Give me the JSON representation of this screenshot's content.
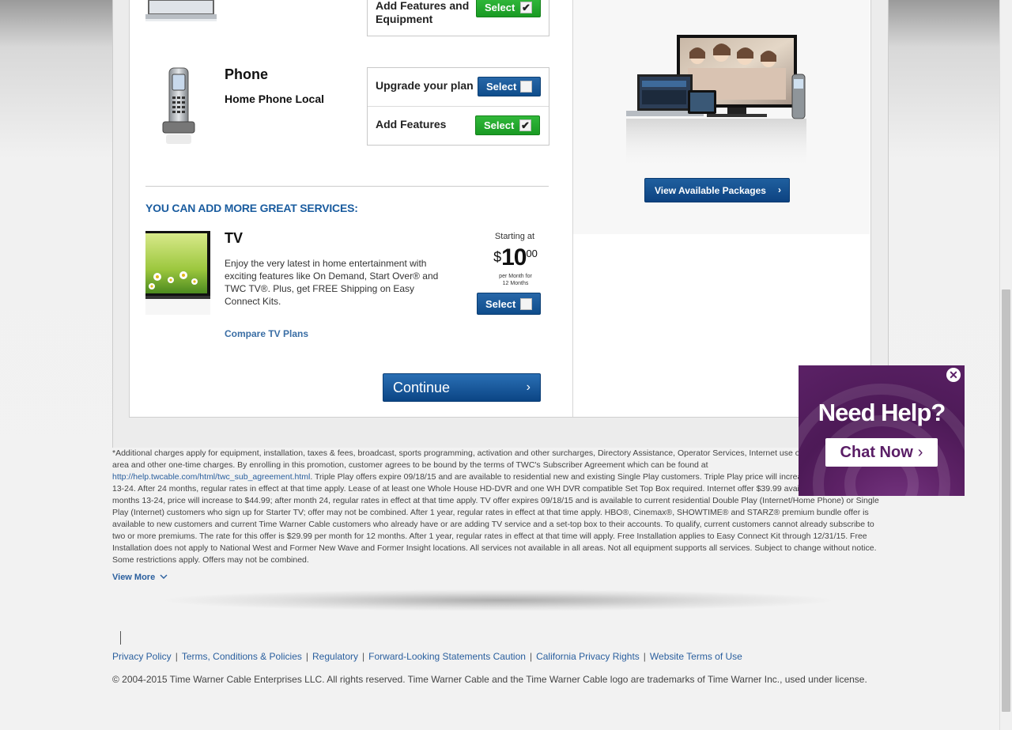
{
  "internet": {
    "add_features_label": "Add Features and Equipment",
    "select_label": "Select",
    "checked": true
  },
  "phone": {
    "title": "Phone",
    "plan": "Home Phone Local",
    "upgrade_label": "Upgrade your plan",
    "upgrade_select": "Select",
    "upgrade_checked": false,
    "add_features_label": "Add Features",
    "add_features_select": "Select",
    "add_features_checked": true
  },
  "more_services": {
    "heading": "YOU CAN ADD MORE GREAT SERVICES:",
    "tv": {
      "title": "TV",
      "description": "Enjoy the very latest in home entertainment with exciting features like On Demand, Start Over® and TWC TV®. Plus, get FREE Shipping on Easy Connect Kits.",
      "compare_link": "Compare TV Plans",
      "starting_at": "Starting at",
      "price_currency": "$",
      "price_dollars": "10",
      "price_cents": "00",
      "per_month_line1": "per Month for",
      "per_month_line2": "12 Months",
      "select_label": "Select",
      "checked": false
    }
  },
  "continue_label": "Continue",
  "packages": {
    "button_label": "View Available Packages"
  },
  "disclaimer": {
    "text_part1": "*Additional charges apply for equipment, installation, taxes & fees, broadcast, sports programming, activation and other surcharges, Directory Assistance, Operator Services, Internet use outside of the calling area and other one-time charges. By enrolling in this promotion, customer agrees to be bound by the terms of TWC's Subscriber Agreement which can be found at ",
    "link": "http://help.twcable.com/html/twc_sub_agreement.html",
    "text_part2": ". Triple Play offers expire 09/18/15 and are available to residential new and existing Single Play customers. Triple Play price will increase month for months 13-24. After 24 months, regular rates in effect at that time apply. Lease of at least one Whole House HD-DVR and one WH DVR compatible Set Top Box required. Internet offer $39.99 available for 12 months; in months 13-24, price will increase to $44.99; after month 24, regular rates in effect at that time apply. TV offer expires 09/18/15 and is available to current residential Double Play (Internet/Home Phone) or Single Play (Internet) customers who sign up for Starter TV; offer may not be combined. After 1 year, regular rates in effect at that time apply. HBO®, Cinemax®, SHOWTIME® and STARZ® premium bundle offer is available to new customers and current Time Warner Cable customers who already have or are adding TV service and a set-top box to their accounts. To qualify, current customers cannot already subscribe to two or more premiums. The rate for this offer is $29.99 per month for 12 months. After 1 year, regular rates in effect at that time will apply. Free Installation applies to Easy Connect Kit through 12/31/15. Free Installation does not apply to National West and Former New Wave and Former Insight locations. All services not available in all areas. Not all equipment supports all services. Subject to change without notice. Some restrictions apply. Offers may not be combined.",
    "view_more": "View More"
  },
  "footer": {
    "links": [
      "Privacy Policy",
      "Terms, Conditions & Policies",
      "Regulatory",
      "Forward-Looking Statements Caution",
      "California Privacy Rights",
      "Website Terms of Use"
    ],
    "copyright": "© 2004-2015 Time Warner Cable Enterprises LLC. All rights reserved. Time Warner Cable and the Time Warner Cable logo are trademarks of Time Warner Inc., used under license."
  },
  "chat": {
    "title": "Need Help?",
    "button_label": "Chat Now",
    "close_glyph": "✕"
  },
  "colors": {
    "accent_blue": "#0f4d8b",
    "accent_green": "#1a9a24",
    "chat_purple": "#5a1e66",
    "link_blue": "#2a5f9e"
  }
}
